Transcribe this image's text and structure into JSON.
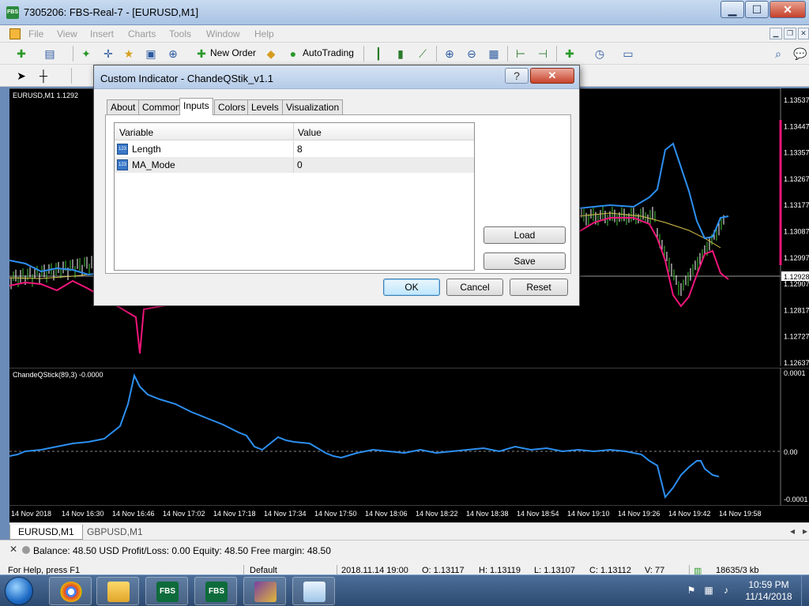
{
  "window": {
    "title": "7305206: FBS-Real-7 - [EURUSD,M1]",
    "app_icon_text": "FBS",
    "min_glyph": "▁",
    "max_glyph": "☐",
    "close_glyph": "✕"
  },
  "menu": {
    "items": [
      "File",
      "View",
      "Insert",
      "Charts",
      "Tools",
      "Window",
      "Help"
    ]
  },
  "toolbar": {
    "new_order_label": "New Order",
    "autotrading_label": "AutoTrading"
  },
  "main_chart": {
    "symbol_label": "EURUSD,M1  1.1292",
    "price_ticks": [
      "1.13537",
      "1.13447",
      "1.13357",
      "1.13267",
      "1.13177",
      "1.13087",
      "1.12997",
      "1.12907",
      "1.12817",
      "1.12727",
      "1.12637"
    ],
    "current_price": "1.12928"
  },
  "indicator_chart": {
    "label": "ChandeQStick(89,3) -0.0000",
    "ticks": [
      "0.0001",
      "0.00",
      "-0.0001"
    ]
  },
  "x_axis": {
    "labels": [
      "14 Nov 2018",
      "14 Nov 16:30",
      "14 Nov 16:46",
      "14 Nov 17:02",
      "14 Nov 17:18",
      "14 Nov 17:34",
      "14 Nov 17:50",
      "14 Nov 18:06",
      "14 Nov 18:22",
      "14 Nov 18:38",
      "14 Nov 18:54",
      "14 Nov 19:10",
      "14 Nov 19:26",
      "14 Nov 19:42",
      "14 Nov 19:58"
    ]
  },
  "chart_tabs": [
    "EURUSD,M1",
    "GBPUSD,M1"
  ],
  "terminal": {
    "balance_text": "Balance: 48.50 USD  Profit/Loss: 0.00  Equity: 48.50  Free margin: 48.50"
  },
  "statusbar": {
    "help": "For Help, press F1",
    "profile": "Default",
    "datetime": "2018.11.14 19:00",
    "open": "O: 1.13117",
    "high": "H: 1.13119",
    "low": "L: 1.13107",
    "close": "C: 1.13112",
    "volume": "V: 77",
    "traffic": "18635/3 kb"
  },
  "dialog": {
    "title": "Custom Indicator - ChandeQStik_v1.1",
    "tabs": [
      "About",
      "Common",
      "Inputs",
      "Colors",
      "Levels",
      "Visualization"
    ],
    "active_tab": "Inputs",
    "table": {
      "headers": [
        "Variable",
        "Value"
      ],
      "rows": [
        {
          "name": "Length",
          "value": "8",
          "icon": "123"
        },
        {
          "name": "MA_Mode",
          "value": "0",
          "icon": "123"
        }
      ]
    },
    "buttons": {
      "load": "Load",
      "save": "Save",
      "ok": "OK",
      "cancel": "Cancel",
      "reset": "Reset"
    }
  },
  "taskbar": {
    "fbs_label_1": "FBS",
    "fbs_label_2": "FBS",
    "time": "10:59 PM",
    "date": "11/14/2018"
  },
  "colors": {
    "chart_bg": "#000000",
    "series_blue": "#2d8ff0",
    "series_magenta": "#f0157a",
    "series_yellow": "#d8c34a",
    "candle_green": "#46c83c"
  }
}
